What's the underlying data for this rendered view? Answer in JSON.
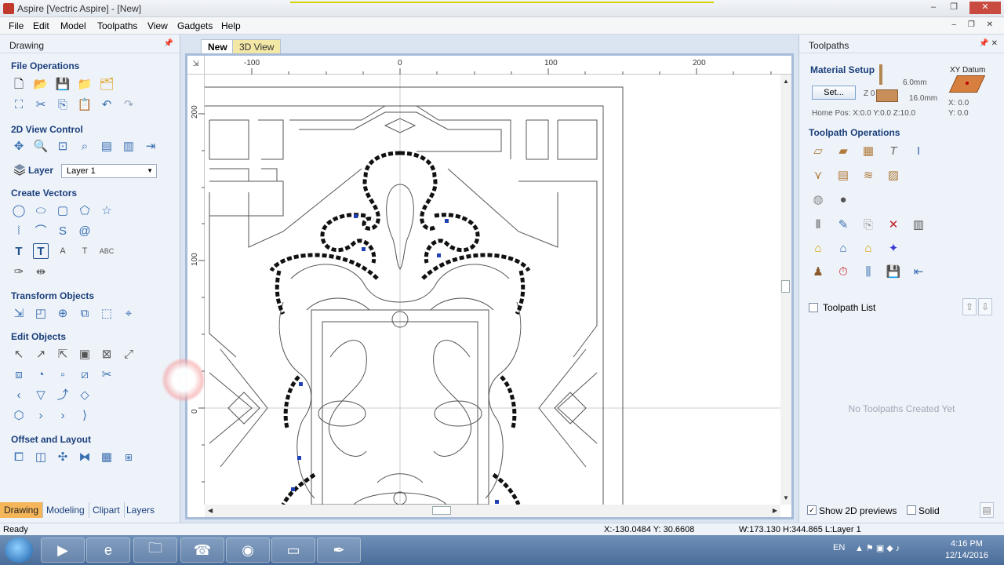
{
  "window": {
    "title": "Aspire [Vectric Aspire] - [New]",
    "controls": [
      "–",
      "❐",
      "✕"
    ]
  },
  "menu": [
    "File",
    "Edit",
    "Model",
    "Toolpaths",
    "View",
    "Gadgets",
    "Help"
  ],
  "left_panel": {
    "title": "Drawing",
    "sections": {
      "file_ops": "File Operations",
      "view_ctrl": "2D View Control",
      "layer": "Layer",
      "layer_value": "Layer 1",
      "create_vectors": "Create Vectors",
      "transform": "Transform Objects",
      "edit": "Edit Objects",
      "offset": "Offset and Layout"
    },
    "tabs": [
      "Drawing",
      "Modeling",
      "Clipart",
      "Layers"
    ]
  },
  "document": {
    "tabs": [
      "New",
      "3D View"
    ],
    "ruler_top": [
      "-100",
      "0",
      "100",
      "200"
    ],
    "ruler_left": [
      "200",
      "100",
      "0"
    ]
  },
  "right_panel": {
    "title": "Toolpaths",
    "material_setup": "Material Setup",
    "set_button": "Set...",
    "z_zero": "Z 0",
    "dim1": "6.0mm",
    "dim2": "16.0mm",
    "xy_datum": "XY Datum",
    "x_val": "X: 0.0",
    "y_val": "Y: 0.0",
    "home_pos": "Home Pos:  X:0.0 Y:0.0 Z:10.0",
    "toolpath_ops": "Toolpath Operations",
    "toolpath_list": "Toolpath List",
    "empty_msg": "No Toolpaths Created Yet",
    "show_previews": "Show 2D previews",
    "solid": "Solid"
  },
  "status": {
    "ready": "Ready",
    "cursor": "X:-130.0484 Y: 30.6608",
    "dims": "W:173.130   H:344.865  L:Layer 1"
  },
  "taskbar": {
    "lang": "EN",
    "time": "4:16 PM",
    "date": "12/14/2016"
  },
  "colors": {
    "accent": "#f5b65a",
    "panel_bg": "#eef3fa",
    "section_title": "#1b3f7a"
  }
}
